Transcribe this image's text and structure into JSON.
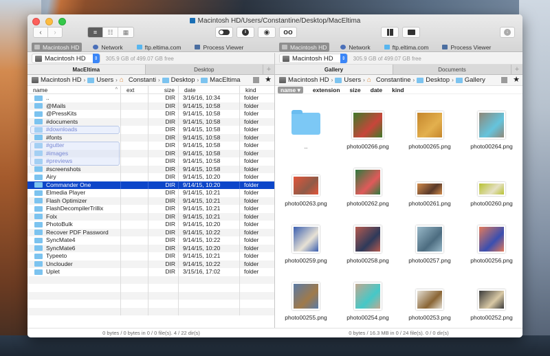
{
  "window": {
    "title": "Macintosh HD/Users/Constantine/Desktop/MacEltima"
  },
  "toolbar": {
    "back_icon": "chevron-left-icon",
    "forward_icon": "chevron-right-icon",
    "view_modes": [
      {
        "name": "list-view-icon",
        "glyph": "≡",
        "active": true
      },
      {
        "name": "brief-view-icon",
        "glyph": "☷",
        "active": false
      },
      {
        "name": "thumbnail-view-icon",
        "glyph": "▦",
        "active": false
      }
    ],
    "buttons": [
      {
        "name": "toggle-hidden-icon",
        "glyph": "◐"
      },
      {
        "name": "info-icon",
        "glyph": "ℹ"
      },
      {
        "name": "preview-eye-icon",
        "glyph": "◉"
      },
      {
        "name": "search-binoculars-icon",
        "glyph": "∞"
      },
      {
        "name": "archive-icon",
        "glyph": "▮▮"
      },
      {
        "name": "network-folder-icon",
        "glyph": "▬"
      },
      {
        "name": "download-icon",
        "glyph": "⬇"
      }
    ]
  },
  "favorites": [
    {
      "label": "Macintosh HD",
      "icon": "hard-drive-icon",
      "active": true,
      "color": "#8a8a8a"
    },
    {
      "label": "Network",
      "icon": "globe-icon",
      "active": false,
      "color": "#4a6fb8"
    },
    {
      "label": "ftp.eltima.com",
      "icon": "ftp-icon",
      "active": false,
      "color": "#58b6ef"
    },
    {
      "label": "Process Viewer",
      "icon": "monitor-icon",
      "active": false,
      "color": "#4b6ea0"
    }
  ],
  "left": {
    "drive": "Macintosh HD",
    "free": "305.9 GB of 499.07 GB free",
    "tabs": [
      {
        "label": "MacEltima",
        "active": true
      },
      {
        "label": "Desktop",
        "active": false
      }
    ],
    "breadcrumb": [
      "Macintosh HD",
      "Users",
      "Constanti",
      "Desktop",
      "MacEltima"
    ],
    "columns": {
      "name": "name",
      "ext": "ext",
      "size": "size",
      "date": "date",
      "kind": "kind"
    },
    "rows": [
      {
        "name": "..",
        "ext": "",
        "size": "DIR",
        "date": "3/16/16, 10:34",
        "kind": "folder"
      },
      {
        "name": "@Mails",
        "ext": "",
        "size": "DIR",
        "date": "9/14/15, 10:58",
        "kind": "folder"
      },
      {
        "name": "@PressKits",
        "ext": "",
        "size": "DIR",
        "date": "9/14/15, 10:58",
        "kind": "folder"
      },
      {
        "name": "#documents",
        "ext": "",
        "size": "DIR",
        "date": "9/14/15, 10:58",
        "kind": "folder"
      },
      {
        "name": "#downloads",
        "ext": "",
        "size": "DIR",
        "date": "9/14/15, 10:58",
        "kind": "folder",
        "tagged": true
      },
      {
        "name": "#fonts",
        "ext": "",
        "size": "DIR",
        "date": "9/14/15, 10:58",
        "kind": "folder"
      },
      {
        "name": "#gutter",
        "ext": "",
        "size": "DIR",
        "date": "9/14/15, 10:58",
        "kind": "folder",
        "tagged": true
      },
      {
        "name": "#images",
        "ext": "",
        "size": "DIR",
        "date": "9/14/15, 10:58",
        "kind": "folder",
        "tagged": true
      },
      {
        "name": "#previews",
        "ext": "",
        "size": "DIR",
        "date": "9/14/15, 10:58",
        "kind": "folder",
        "tagged": true
      },
      {
        "name": "#screenshots",
        "ext": "",
        "size": "DIR",
        "date": "9/14/15, 10:58",
        "kind": "folder"
      },
      {
        "name": "Airy",
        "ext": "",
        "size": "DIR",
        "date": "9/14/15, 10:20",
        "kind": "folder"
      },
      {
        "name": "Commander One",
        "ext": "",
        "size": "DIR",
        "date": "9/14/15, 10:20",
        "kind": "folder",
        "selected": true
      },
      {
        "name": "Elmedia Player",
        "ext": "",
        "size": "DIR",
        "date": "9/14/15, 10:21",
        "kind": "folder"
      },
      {
        "name": "Flash Optimizer",
        "ext": "",
        "size": "DIR",
        "date": "9/14/15, 10:21",
        "kind": "folder"
      },
      {
        "name": "FlashDecompilerTrillix",
        "ext": "",
        "size": "DIR",
        "date": "9/14/15, 10:21",
        "kind": "folder"
      },
      {
        "name": "Folx",
        "ext": "",
        "size": "DIR",
        "date": "9/14/15, 10:21",
        "kind": "folder"
      },
      {
        "name": "PhotoBulk",
        "ext": "",
        "size": "DIR",
        "date": "9/14/15, 10:20",
        "kind": "folder"
      },
      {
        "name": "Recover PDF Password",
        "ext": "",
        "size": "DIR",
        "date": "9/14/15, 10:22",
        "kind": "folder"
      },
      {
        "name": "SyncMate4",
        "ext": "",
        "size": "DIR",
        "date": "9/14/15, 10:22",
        "kind": "folder"
      },
      {
        "name": "SyncMate6",
        "ext": "",
        "size": "DIR",
        "date": "9/14/15, 10:20",
        "kind": "folder"
      },
      {
        "name": "Typeeto",
        "ext": "",
        "size": "DIR",
        "date": "9/14/15, 10:21",
        "kind": "folder"
      },
      {
        "name": "Unclouder",
        "ext": "",
        "size": "DIR",
        "date": "9/14/15, 10:22",
        "kind": "folder"
      },
      {
        "name": "Uplet",
        "ext": "",
        "size": "DIR",
        "date": "3/15/16, 17:02",
        "kind": "folder"
      }
    ],
    "status": "0 bytes / 0 bytes in 0 / 0 file(s). 4 / 22 dir(s)"
  },
  "right": {
    "drive": "Macintosh HD",
    "free": "305.9 GB of 499.07 GB free",
    "tabs": [
      {
        "label": "Gallery",
        "active": true
      },
      {
        "label": "Documents",
        "active": false
      }
    ],
    "breadcrumb": [
      "Macintosh HD",
      "Users",
      "Constantine",
      "Desktop",
      "Gallery"
    ],
    "columns": {
      "name": "name",
      "extension": "extension",
      "size": "size",
      "date": "date",
      "kind": "kind"
    },
    "items": [
      {
        "label": "..",
        "folder": true
      },
      {
        "label": "photo00266.png",
        "c1": "#3f7a2a",
        "c2": "#c8453a",
        "w": 46,
        "h": 40
      },
      {
        "label": "photo00265.png",
        "c1": "#c5862c",
        "c2": "#e3b04e",
        "w": 40,
        "h": 40
      },
      {
        "label": "photo00264.png",
        "c1": "#8f8778",
        "c2": "#65c4dd",
        "w": 40,
        "h": 40
      },
      {
        "label": "photo00263.png",
        "c1": "#e2553a",
        "c2": "#8f5b48",
        "w": 40,
        "h": 30
      },
      {
        "label": "photo00262.png",
        "c1": "#2f7a3f",
        "c2": "#e05a5a",
        "w": 40,
        "h": 40
      },
      {
        "label": "photo00261.png",
        "c1": "#d08a4a",
        "c2": "#5a3a2a",
        "w": 40,
        "h": 20
      },
      {
        "label": "photo00260.png",
        "c1": "#b8c232",
        "c2": "#e5e0c5",
        "w": 40,
        "h": 20
      },
      {
        "label": "photo00259.png",
        "c1": "#3b5fb0",
        "c2": "#e8e2d5",
        "w": 40,
        "h": 40
      },
      {
        "label": "photo00258.png",
        "c1": "#b65a4f",
        "c2": "#2e3a5a",
        "w": 40,
        "h": 40
      },
      {
        "label": "photo00257.png",
        "c1": "#98b8c8",
        "c2": "#4c6c80",
        "w": 40,
        "h": 40
      },
      {
        "label": "photo00256.png",
        "c1": "#e37a5a",
        "c2": "#3a4fb0",
        "w": 40,
        "h": 40
      },
      {
        "label": "photo00255.png",
        "c1": "#5a7aa5",
        "c2": "#a07a4a",
        "w": 40,
        "h": 40
      },
      {
        "label": "photo00254.png",
        "c1": "#c0a890",
        "c2": "#45c8c8",
        "w": 40,
        "h": 40
      },
      {
        "label": "photo00253.png",
        "c1": "#e5e0d5",
        "c2": "#8a6535",
        "w": 40,
        "h": 30
      },
      {
        "label": "photo00252.png",
        "c1": "#3a3a3a",
        "c2": "#d9c9a5",
        "w": 40,
        "h": 30
      }
    ],
    "status": "0 bytes / 16.3 MB in 0 / 24 file(s). 0 / 0 dir(s)"
  },
  "colors": {
    "selection": "#0d46c9",
    "folder": "#7cc3ef",
    "tag_text": "#2b3fb4",
    "stepper": "#3b86f7"
  }
}
